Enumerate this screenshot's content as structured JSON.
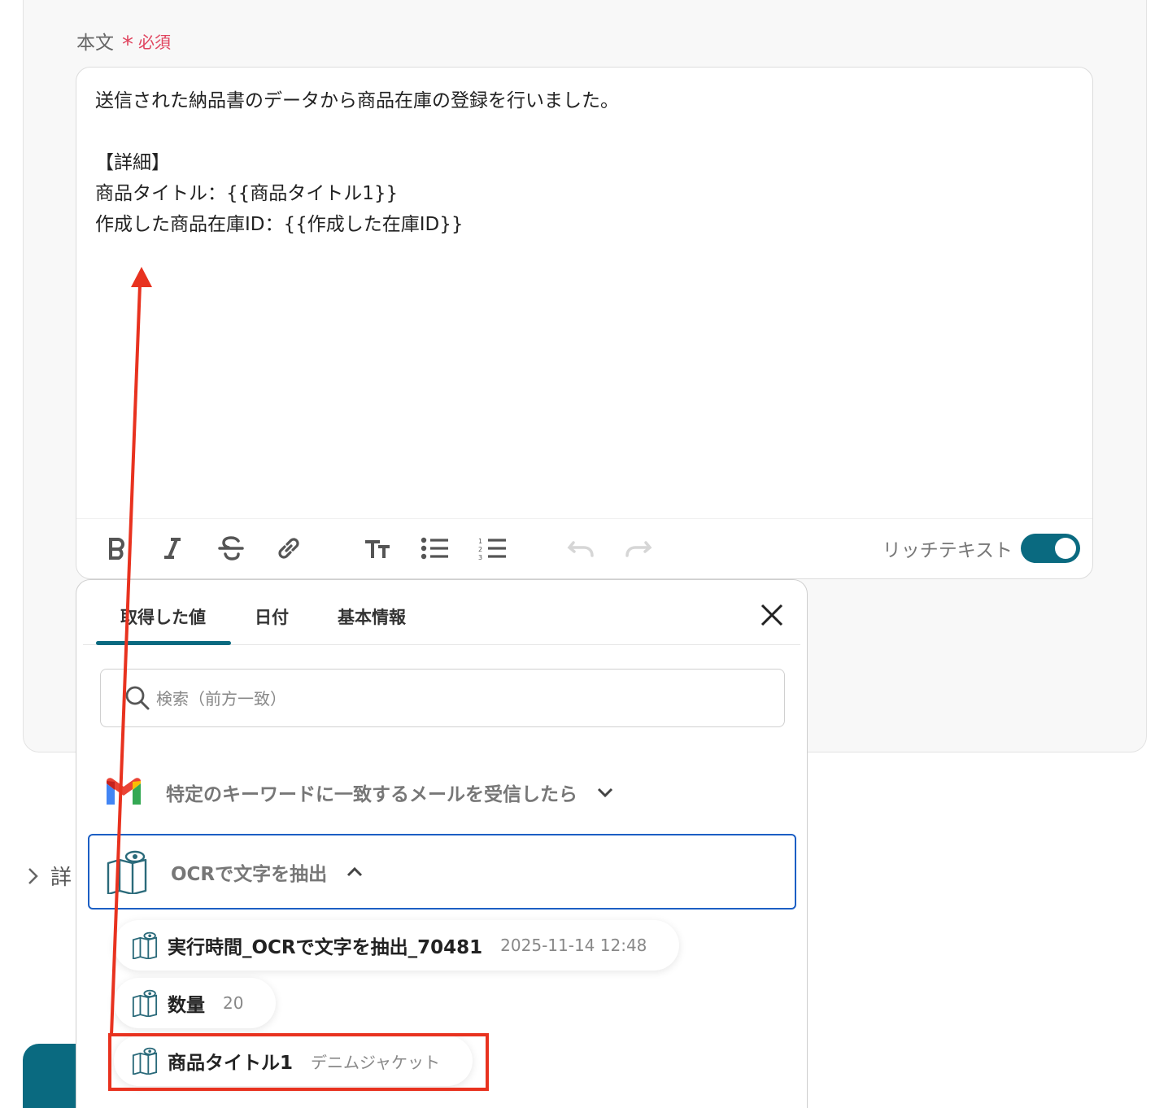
{
  "form": {
    "field_label": "本文",
    "required_label": "必須",
    "body_lines": [
      "送信された納品書のデータから商品在庫の登録を行いました。",
      "",
      "【詳細】",
      "商品タイトル：{{商品タイトル1}}",
      "作成した商品在庫ID：{{作成した在庫ID}}"
    ],
    "toolbar": {
      "icons": [
        "bold-icon",
        "italic-icon",
        "strikethrough-icon",
        "link-icon",
        "text-size-icon",
        "bullet-list-icon",
        "numbered-list-icon",
        "undo-icon",
        "redo-icon"
      ],
      "rich_text_label": "リッチテキスト",
      "rich_text_enabled": true
    }
  },
  "side": {
    "detail_label": "詳"
  },
  "panel": {
    "tabs": [
      "取得した値",
      "日付",
      "基本情報"
    ],
    "active_tab": "取得した値",
    "search_placeholder": "検索（前方一致）",
    "groups": [
      {
        "label": "特定のキーワードに一致するメールを受信したら",
        "icon": "gmail-icon",
        "expanded": false
      },
      {
        "label": "OCRで文字を抽出",
        "icon": "ocr-book-icon",
        "expanded": true
      }
    ],
    "items": [
      {
        "name": "実行時間_OCRで文字を抽出_70481",
        "value": "2025-11-14 12:48"
      },
      {
        "name": "数量",
        "value": "20"
      },
      {
        "name": "商品タイトル1",
        "value": "デニムジャケット"
      }
    ]
  },
  "colors": {
    "accent": "#0a6a80",
    "required": "#e0455f",
    "annotation": "#e8321f",
    "focus": "#1c5fc4"
  }
}
